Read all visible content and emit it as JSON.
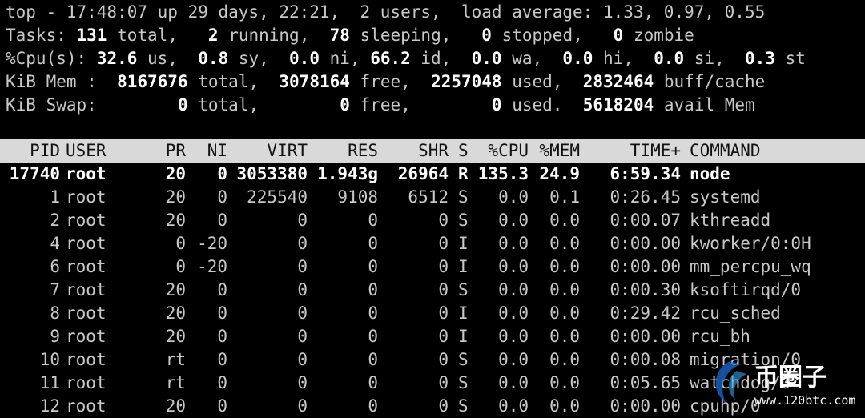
{
  "summary": {
    "line1": "top - 17:48:07 up 29 days, 22:21,  2 users,  load average: 1.33, 0.97, 0.55",
    "tasks": [
      {
        "t": "Tasks: ",
        "b": false
      },
      {
        "t": "131",
        "b": true
      },
      {
        "t": " total,   ",
        "b": false
      },
      {
        "t": "2",
        "b": true
      },
      {
        "t": " running,  ",
        "b": false
      },
      {
        "t": "78",
        "b": true
      },
      {
        "t": " sleeping,   ",
        "b": false
      },
      {
        "t": "0",
        "b": true
      },
      {
        "t": " stopped,   ",
        "b": false
      },
      {
        "t": "0",
        "b": true
      },
      {
        "t": " zombie",
        "b": false
      }
    ],
    "cpu": [
      {
        "t": "%Cpu(s): ",
        "b": false
      },
      {
        "t": "32.6",
        "b": true
      },
      {
        "t": " us,  ",
        "b": false
      },
      {
        "t": "0.8",
        "b": true
      },
      {
        "t": " sy,  ",
        "b": false
      },
      {
        "t": "0.0",
        "b": true
      },
      {
        "t": " ni, ",
        "b": false
      },
      {
        "t": "66.2",
        "b": true
      },
      {
        "t": " id,  ",
        "b": false
      },
      {
        "t": "0.0",
        "b": true
      },
      {
        "t": " wa,  ",
        "b": false
      },
      {
        "t": "0.0",
        "b": true
      },
      {
        "t": " hi,  ",
        "b": false
      },
      {
        "t": "0.0",
        "b": true
      },
      {
        "t": " si,  ",
        "b": false
      },
      {
        "t": "0.3",
        "b": true
      },
      {
        "t": " st",
        "b": false
      }
    ],
    "mem": [
      {
        "t": "KiB Mem :  ",
        "b": false
      },
      {
        "t": "8167676",
        "b": true
      },
      {
        "t": " total,  ",
        "b": false
      },
      {
        "t": "3078164",
        "b": true
      },
      {
        "t": " free,  ",
        "b": false
      },
      {
        "t": "2257048",
        "b": true
      },
      {
        "t": " used,  ",
        "b": false
      },
      {
        "t": "2832464",
        "b": true
      },
      {
        "t": " buff/cache",
        "b": false
      }
    ],
    "swap": [
      {
        "t": "KiB Swap:        ",
        "b": false
      },
      {
        "t": "0",
        "b": true
      },
      {
        "t": " total,        ",
        "b": false
      },
      {
        "t": "0",
        "b": true
      },
      {
        "t": " free,        ",
        "b": false
      },
      {
        "t": "0",
        "b": true
      },
      {
        "t": " used.  ",
        "b": false
      },
      {
        "t": "5618204",
        "b": true
      },
      {
        "t": " avail Mem",
        "b": false
      }
    ]
  },
  "columns": [
    "PID",
    "USER",
    "PR",
    "NI",
    "VIRT",
    "RES",
    "SHR",
    "S",
    "%CPU",
    "%MEM",
    "TIME+",
    "COMMAND"
  ],
  "processes": [
    {
      "pid": "17740",
      "user": "root",
      "pr": "20",
      "ni": "0",
      "virt": "3053380",
      "res": "1.943g",
      "shr": "26964",
      "s": "R",
      "cpu": "135.3",
      "mem": "24.9",
      "time": "6:59.34",
      "command": "node",
      "highlight": true
    },
    {
      "pid": "1",
      "user": "root",
      "pr": "20",
      "ni": "0",
      "virt": "225540",
      "res": "9108",
      "shr": "6512",
      "s": "S",
      "cpu": "0.0",
      "mem": "0.1",
      "time": "0:26.45",
      "command": "systemd"
    },
    {
      "pid": "2",
      "user": "root",
      "pr": "20",
      "ni": "0",
      "virt": "0",
      "res": "0",
      "shr": "0",
      "s": "S",
      "cpu": "0.0",
      "mem": "0.0",
      "time": "0:00.07",
      "command": "kthreadd"
    },
    {
      "pid": "4",
      "user": "root",
      "pr": "0",
      "ni": "-20",
      "virt": "0",
      "res": "0",
      "shr": "0",
      "s": "I",
      "cpu": "0.0",
      "mem": "0.0",
      "time": "0:00.00",
      "command": "kworker/0:0H"
    },
    {
      "pid": "6",
      "user": "root",
      "pr": "0",
      "ni": "-20",
      "virt": "0",
      "res": "0",
      "shr": "0",
      "s": "I",
      "cpu": "0.0",
      "mem": "0.0",
      "time": "0:00.00",
      "command": "mm_percpu_wq"
    },
    {
      "pid": "7",
      "user": "root",
      "pr": "20",
      "ni": "0",
      "virt": "0",
      "res": "0",
      "shr": "0",
      "s": "S",
      "cpu": "0.0",
      "mem": "0.0",
      "time": "0:00.30",
      "command": "ksoftirqd/0"
    },
    {
      "pid": "8",
      "user": "root",
      "pr": "20",
      "ni": "0",
      "virt": "0",
      "res": "0",
      "shr": "0",
      "s": "I",
      "cpu": "0.0",
      "mem": "0.0",
      "time": "0:29.42",
      "command": "rcu_sched"
    },
    {
      "pid": "9",
      "user": "root",
      "pr": "20",
      "ni": "0",
      "virt": "0",
      "res": "0",
      "shr": "0",
      "s": "I",
      "cpu": "0.0",
      "mem": "0.0",
      "time": "0:00.00",
      "command": "rcu_bh"
    },
    {
      "pid": "10",
      "user": "root",
      "pr": "rt",
      "ni": "0",
      "virt": "0",
      "res": "0",
      "shr": "0",
      "s": "S",
      "cpu": "0.0",
      "mem": "0.0",
      "time": "0:00.08",
      "command": "migration/0"
    },
    {
      "pid": "11",
      "user": "root",
      "pr": "rt",
      "ni": "0",
      "virt": "0",
      "res": "0",
      "shr": "0",
      "s": "S",
      "cpu": "0.0",
      "mem": "0.0",
      "time": "0:05.65",
      "command": "watchdog/0"
    },
    {
      "pid": "12",
      "user": "root",
      "pr": "20",
      "ni": "0",
      "virt": "0",
      "res": "0",
      "shr": "0",
      "s": "S",
      "cpu": "0.0",
      "mem": "0.0",
      "time": "0:00.00",
      "command": "cpuhp/0"
    }
  ],
  "watermark": {
    "brand": "币圈子",
    "url": "www.120btc.com"
  }
}
